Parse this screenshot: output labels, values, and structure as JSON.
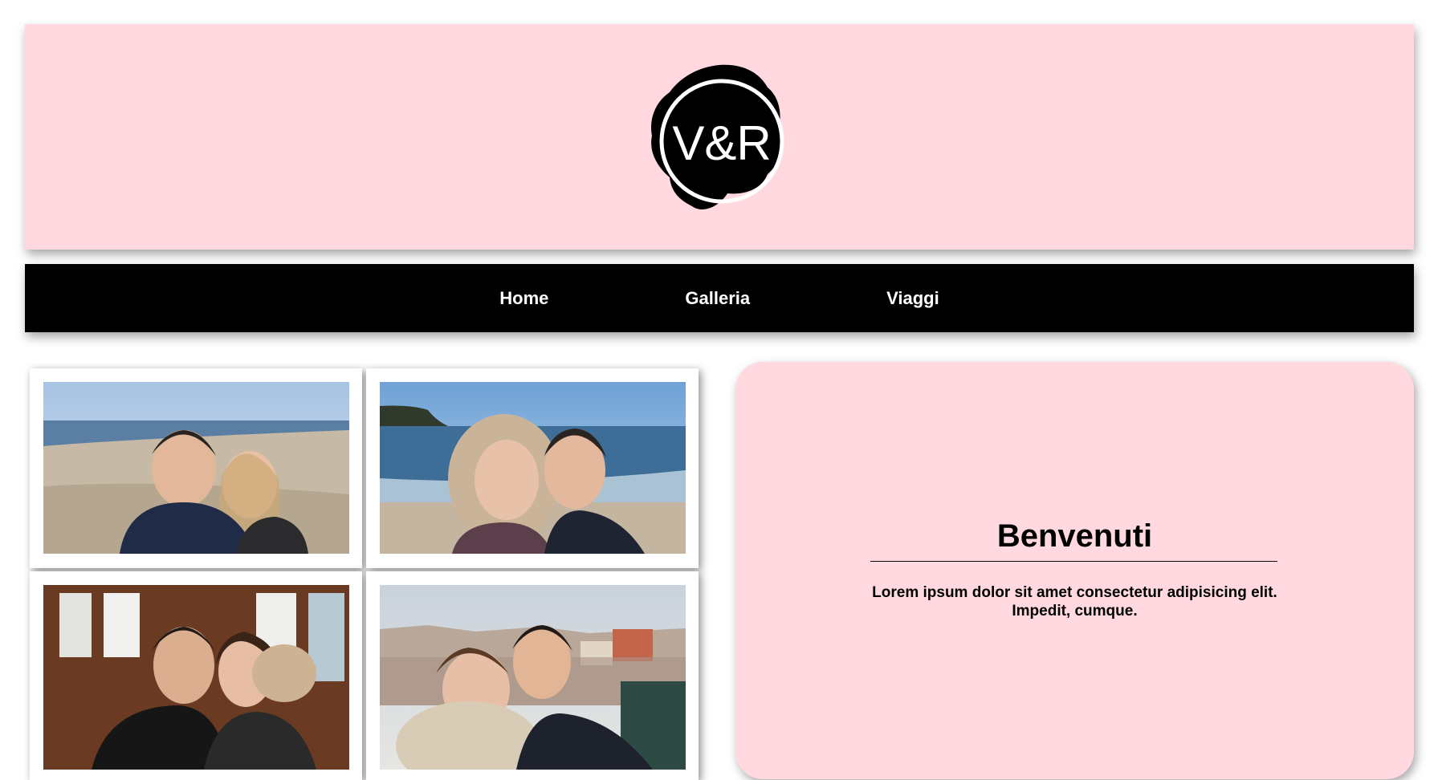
{
  "header": {
    "logo": {
      "text": "V&R",
      "icon": "wax-seal-logo",
      "colors": {
        "seal": "#000000",
        "ring": "#ffffff"
      }
    },
    "background": "#ffd9df"
  },
  "nav": {
    "background": "#000000",
    "items": [
      {
        "label": "Home"
      },
      {
        "label": "Galleria"
      },
      {
        "label": "Viaggi"
      }
    ]
  },
  "gallery": {
    "photos": [
      {
        "name": "beach-selfie",
        "scene": "beach"
      },
      {
        "name": "seaside-selfie",
        "scene": "sea"
      },
      {
        "name": "tram-selfie",
        "scene": "tram"
      },
      {
        "name": "city-view-kiss",
        "scene": "city"
      }
    ]
  },
  "welcome": {
    "title": "Benvenuti",
    "text": "Lorem ipsum dolor sit amet consectetur adipisicing elit. Impedit, cumque.",
    "background": "#ffd9df"
  }
}
